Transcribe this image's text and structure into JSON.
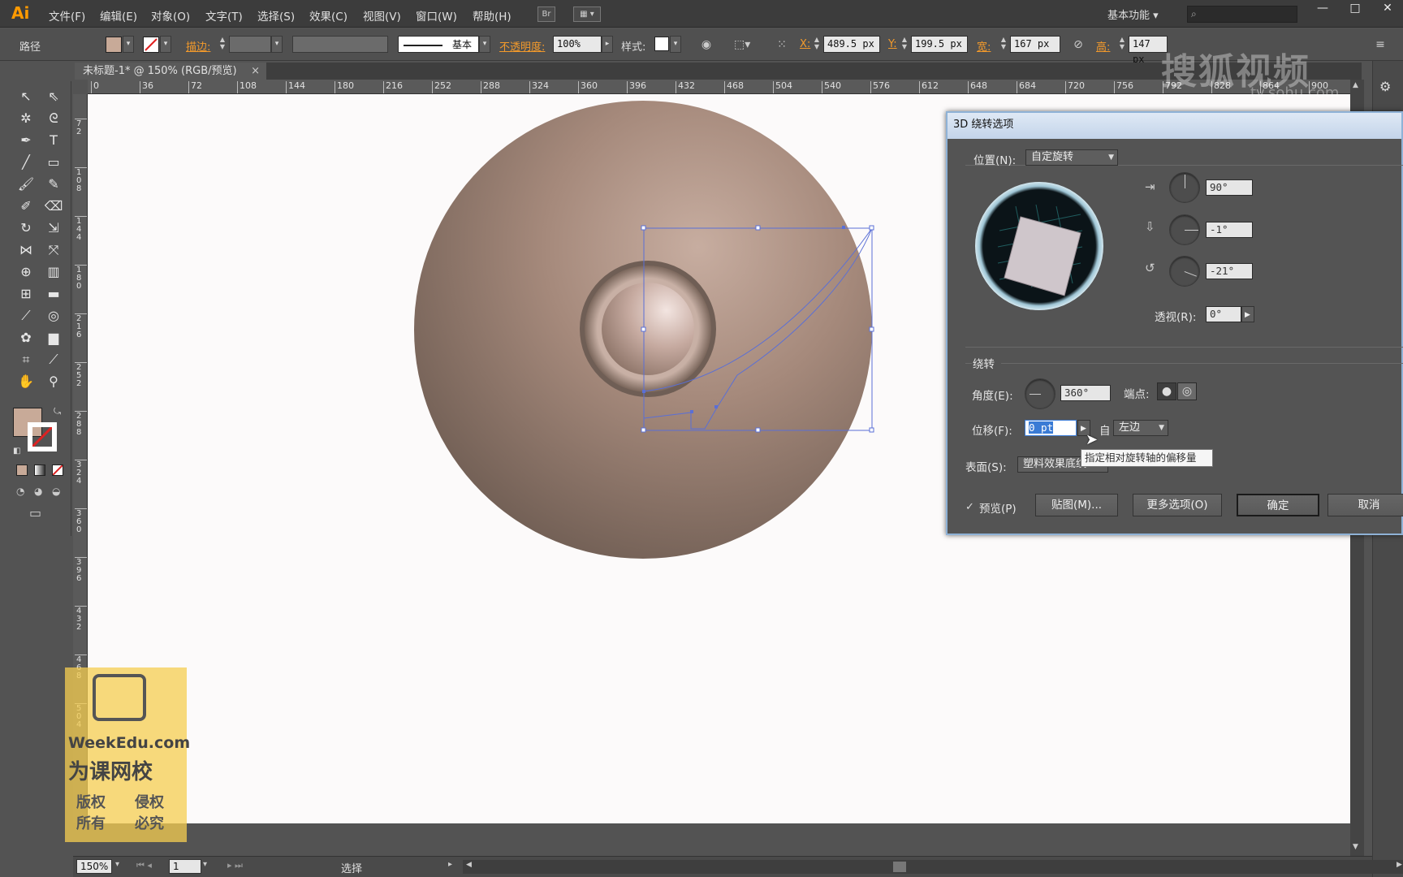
{
  "app": {
    "logo": "Ai",
    "menus": [
      "文件(F)",
      "编辑(E)",
      "对象(O)",
      "文字(T)",
      "选择(S)",
      "效果(C)",
      "视图(V)",
      "窗口(W)",
      "帮助(H)"
    ],
    "bridge_button": "Br",
    "workspace": "基本功能",
    "search_placeholder": "",
    "window_controls": [
      "—",
      "□",
      "✕"
    ]
  },
  "control_bar": {
    "selection_type": "路径",
    "stroke_label": "描边",
    "stroke_profile": "基本",
    "opacity_label": "不透明度",
    "opacity_value": "100%",
    "style_label": "样式",
    "x_label": "X",
    "x_value": "489.5 px",
    "y_label": "Y",
    "y_value": "199.5 px",
    "w_label": "宽",
    "w_value": "167 px",
    "h_label": "高",
    "h_value": "147 px",
    "fill_color": "#c8aa98",
    "colon": ":"
  },
  "document": {
    "tab_title": "未标题-1* @ 150% (RGB/预览)",
    "tab_close": "×"
  },
  "rulers": {
    "top_ticks": [
      "0",
      "36",
      "72",
      "108",
      "144",
      "180",
      "216",
      "252",
      "288",
      "324",
      "360",
      "396",
      "432",
      "468",
      "504",
      "540",
      "576",
      "612",
      "648",
      "684",
      "720",
      "756",
      "792",
      "828",
      "864",
      "900"
    ],
    "left_ticks": [
      "7\n2",
      "1\n0\n8",
      "1\n4\n4",
      "1\n8\n0",
      "2\n1\n6",
      "2\n5\n2",
      "2\n8\n8",
      "3\n2\n4",
      "3\n6\n0",
      "3\n9\n6",
      "4\n3\n2",
      "4\n6\n8",
      "5\n0\n4"
    ]
  },
  "status_bar": {
    "zoom": "150%",
    "artboard": "1",
    "tool": "选择"
  },
  "dialog": {
    "title": "3D 绕转选项",
    "position_label": "位置(N):",
    "position_value": "自定旋转",
    "x_angle": "90°",
    "y_angle": "-1°",
    "z_angle": "-21°",
    "perspective_label": "透视(R):",
    "perspective_value": "0°",
    "revolve_group": "绕转",
    "angle_label": "角度(E):",
    "angle_value": "360°",
    "cap_label": "端点:",
    "offset_label": "位移(F):",
    "offset_value": "0 pt",
    "from_label": "自",
    "from_value": "左边",
    "surface_label": "表面(S):",
    "surface_value": "塑料效果底纹",
    "preview_label": "预览(P)",
    "preview_checked": true,
    "map_button": "贴图(M)...",
    "more_button": "更多选项(O)",
    "ok_button": "确定",
    "cancel_button": "取消",
    "tooltip": "指定相对旋转轴的偏移量"
  },
  "watermarks": {
    "sohu": "搜狐视频",
    "sohu_url": "tv.sohu.com",
    "weekedu_brand": "WeekEdu.com",
    "weekedu_name": "为课网校",
    "copyright_1": "版权",
    "copyright_2": "所有",
    "rights_1": "侵权",
    "rights_2": "必究"
  }
}
